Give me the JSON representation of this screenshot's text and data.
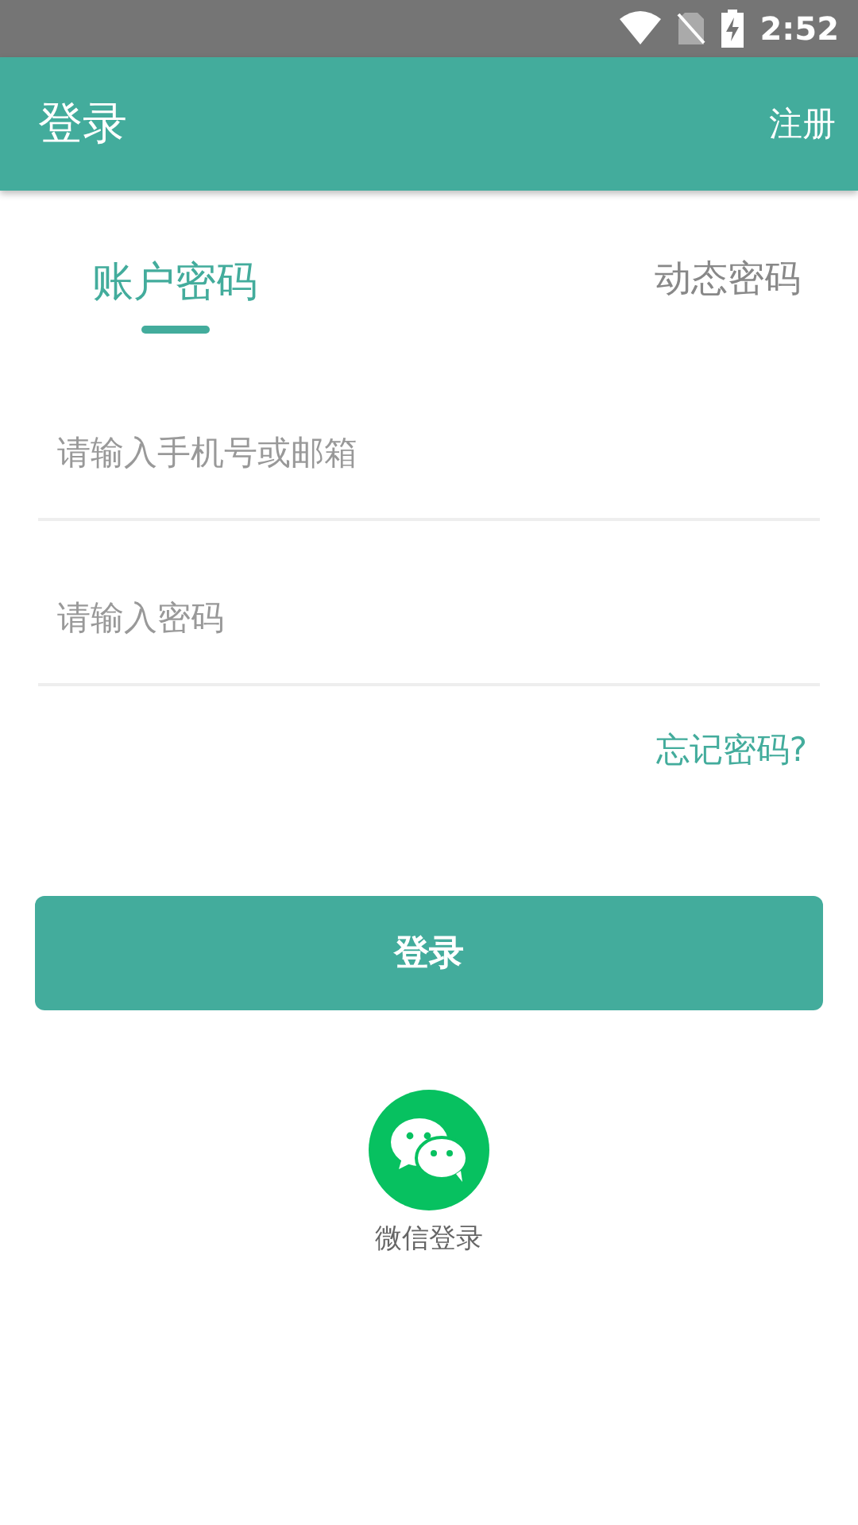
{
  "status_bar": {
    "time": "2:52"
  },
  "toolbar": {
    "title": "登录",
    "action": "注册"
  },
  "tabs": [
    {
      "label": "账户密码",
      "selected": true
    },
    {
      "label": "动态密码",
      "selected": false
    }
  ],
  "fields": [
    {
      "placeholder": "请输入手机号或邮箱"
    },
    {
      "placeholder": "请输入密码"
    }
  ],
  "forgot_link": "忘记密码?",
  "login_button": "登录",
  "wechat_login": {
    "label": "微信登录"
  }
}
